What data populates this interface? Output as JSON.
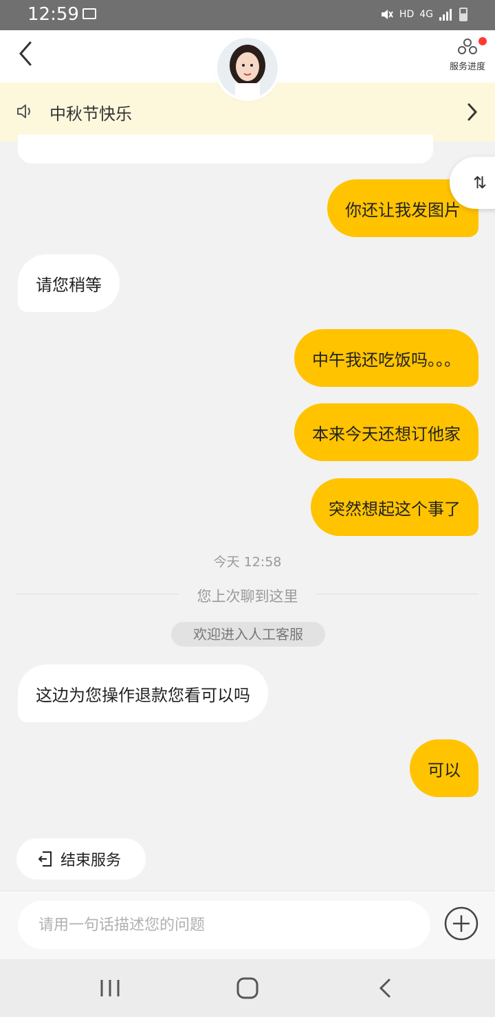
{
  "status_bar": {
    "time": "12:59",
    "hd": "HD",
    "net": "4G"
  },
  "header": {
    "service_progress_label": "服务进度"
  },
  "notice": {
    "text": "中秋节快乐"
  },
  "messages": [
    {
      "from": "me",
      "text": "你还让我发图片"
    },
    {
      "from": "them",
      "text": "请您稍等"
    },
    {
      "from": "me",
      "text": "中午我还吃饭吗。。。"
    },
    {
      "from": "me",
      "text": "本来今天还想订他家"
    },
    {
      "from": "me",
      "text": "突然想起这个事了"
    },
    {
      "from": "them",
      "text": "这边为您操作退款您看可以吗"
    },
    {
      "from": "me",
      "text": "可以"
    }
  ],
  "timestamp": "今天 12:58",
  "last_read_divider": "您上次聊到这里",
  "welcome_pill": "欢迎进入人工客服",
  "scroll_toggle_glyph": "⇅",
  "end_service_label": "结束服务",
  "input": {
    "placeholder": "请用一句话描述您的问题"
  },
  "colors": {
    "accent": "#ffc300",
    "notice_bg": "#fdf8dc",
    "badge": "#ff3b30"
  }
}
